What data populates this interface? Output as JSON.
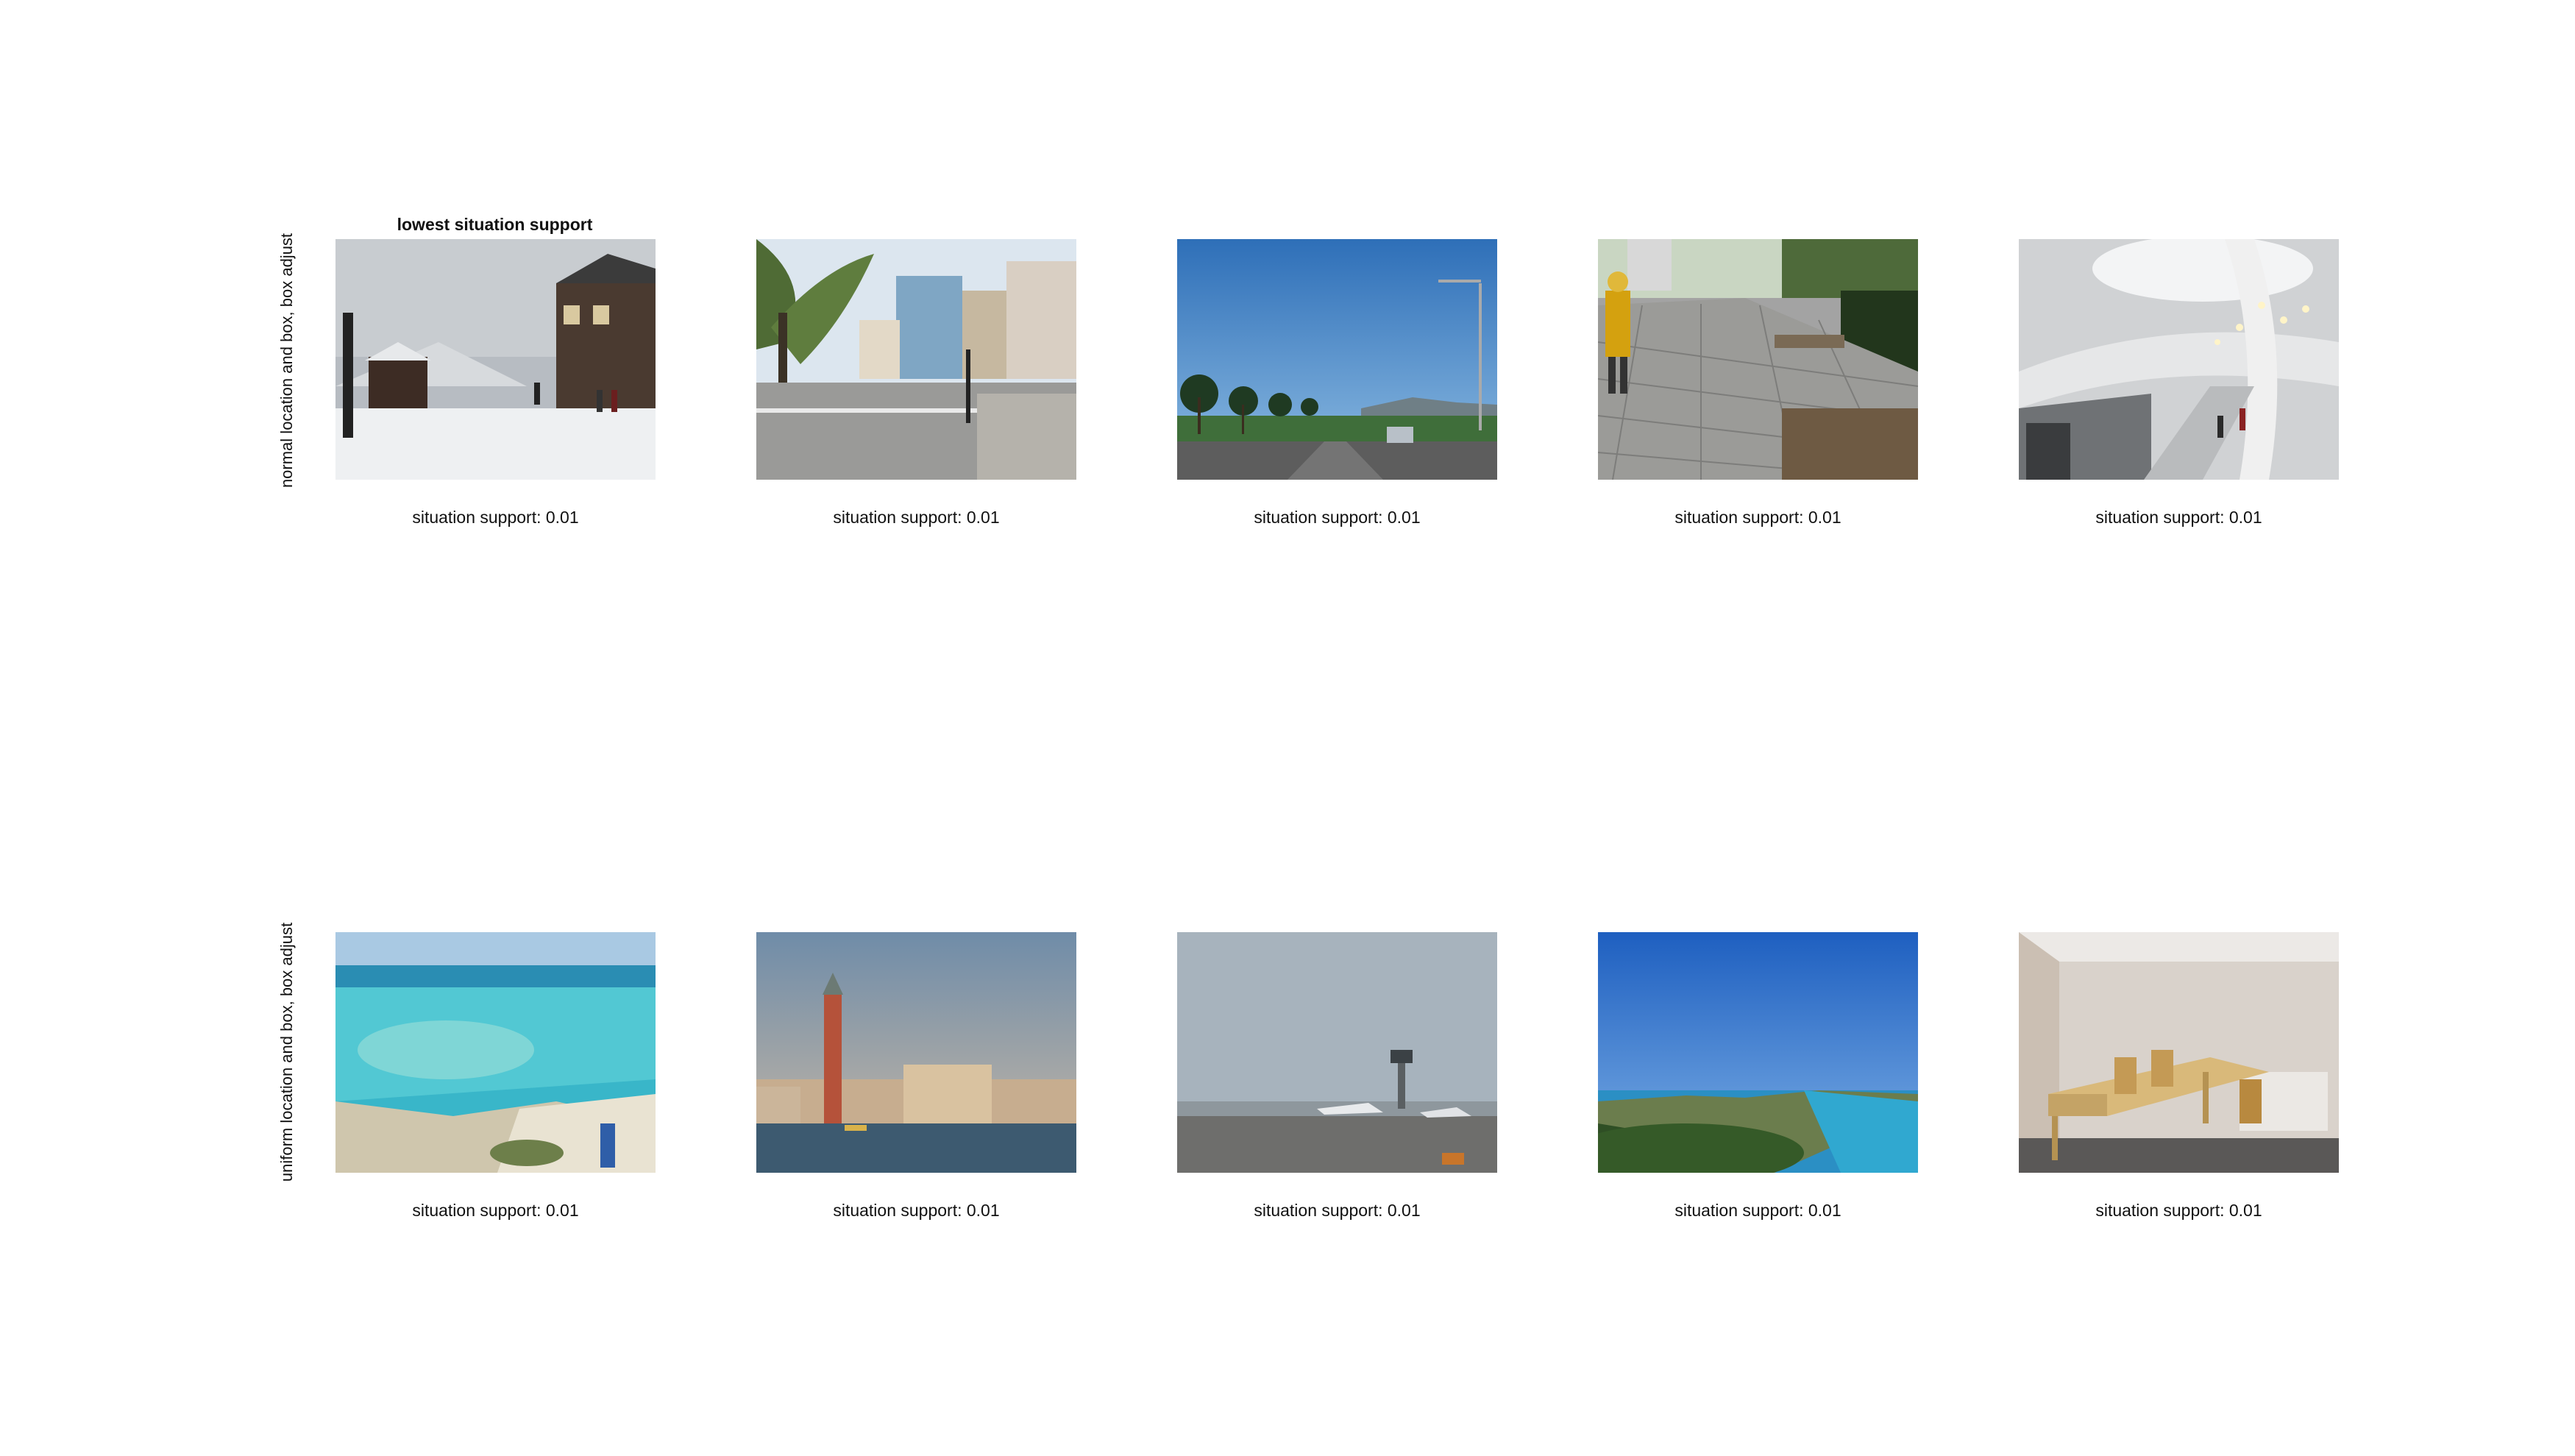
{
  "header": "lowest situation support",
  "rows": [
    {
      "label": "normal location and box, box adjust",
      "cells": [
        {
          "caption": "situation support: 0.01",
          "scene": "snowy-village"
        },
        {
          "caption": "situation support: 0.01",
          "scene": "city-street"
        },
        {
          "caption": "situation support: 0.01",
          "scene": "palm-road"
        },
        {
          "caption": "situation support: 0.01",
          "scene": "paved-sidewalk"
        },
        {
          "caption": "situation support: 0.01",
          "scene": "mall-interior"
        }
      ]
    },
    {
      "label": "uniform location and box, box adjust",
      "cells": [
        {
          "caption": "situation support: 0.01",
          "scene": "turquoise-beach"
        },
        {
          "caption": "situation support: 0.01",
          "scene": "venice-waterfront"
        },
        {
          "caption": "situation support: 0.01",
          "scene": "airport-tarmac"
        },
        {
          "caption": "situation support: 0.01",
          "scene": "coastal-view"
        },
        {
          "caption": "situation support: 0.01",
          "scene": "empty-room"
        }
      ]
    }
  ]
}
